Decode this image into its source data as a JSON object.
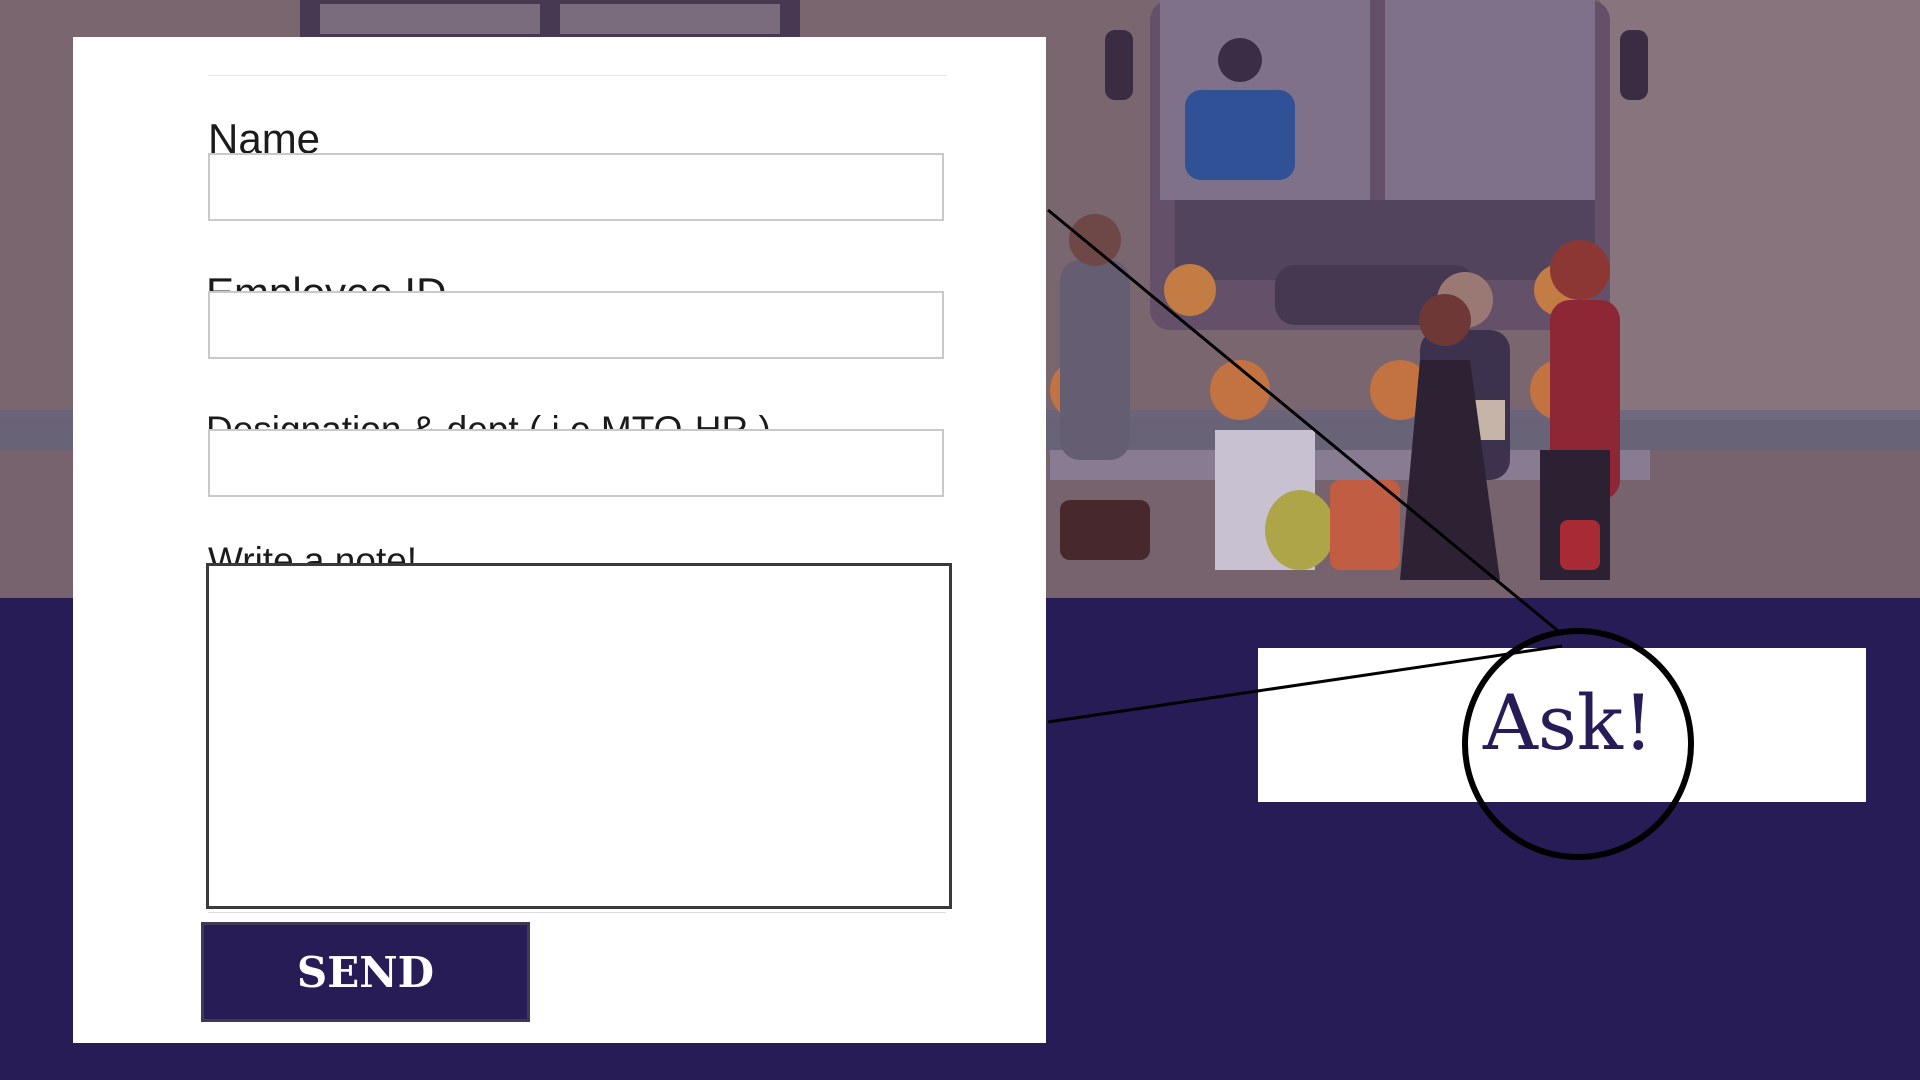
{
  "form": {
    "name_label": "Name",
    "name_value": "",
    "employee_id_label": "Employee ID",
    "employee_id_value": "",
    "designation_label": "Designation & dept ( i.e MTO-HR )",
    "designation_value": "",
    "note_label": "Write a note!",
    "note_value": "",
    "send_label": "SEND"
  },
  "callout": {
    "text": "Ask!"
  },
  "colors": {
    "primary": "#271c55",
    "card": "#ffffff",
    "annotation_stroke": "#000000"
  },
  "illustration": {
    "subject": "bus-station-passengers-illustration"
  }
}
